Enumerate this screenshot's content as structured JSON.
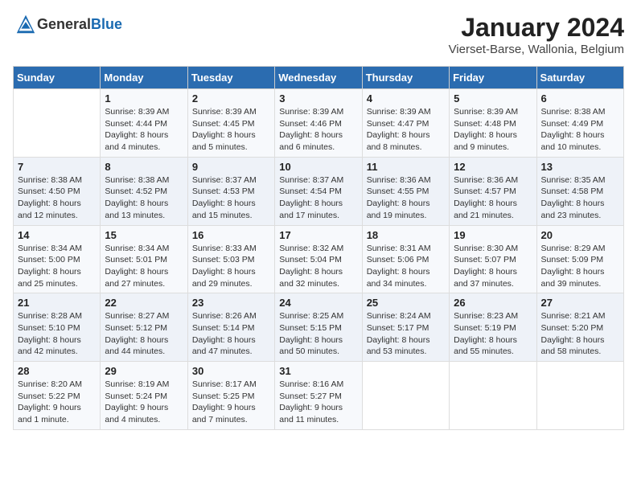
{
  "header": {
    "logo_general": "General",
    "logo_blue": "Blue",
    "month_title": "January 2024",
    "location": "Vierset-Barse, Wallonia, Belgium"
  },
  "weekdays": [
    "Sunday",
    "Monday",
    "Tuesday",
    "Wednesday",
    "Thursday",
    "Friday",
    "Saturday"
  ],
  "weeks": [
    [
      {
        "day": "",
        "sunrise": "",
        "sunset": "",
        "daylight": ""
      },
      {
        "day": "1",
        "sunrise": "Sunrise: 8:39 AM",
        "sunset": "Sunset: 4:44 PM",
        "daylight": "Daylight: 8 hours and 4 minutes."
      },
      {
        "day": "2",
        "sunrise": "Sunrise: 8:39 AM",
        "sunset": "Sunset: 4:45 PM",
        "daylight": "Daylight: 8 hours and 5 minutes."
      },
      {
        "day": "3",
        "sunrise": "Sunrise: 8:39 AM",
        "sunset": "Sunset: 4:46 PM",
        "daylight": "Daylight: 8 hours and 6 minutes."
      },
      {
        "day": "4",
        "sunrise": "Sunrise: 8:39 AM",
        "sunset": "Sunset: 4:47 PM",
        "daylight": "Daylight: 8 hours and 8 minutes."
      },
      {
        "day": "5",
        "sunrise": "Sunrise: 8:39 AM",
        "sunset": "Sunset: 4:48 PM",
        "daylight": "Daylight: 8 hours and 9 minutes."
      },
      {
        "day": "6",
        "sunrise": "Sunrise: 8:38 AM",
        "sunset": "Sunset: 4:49 PM",
        "daylight": "Daylight: 8 hours and 10 minutes."
      }
    ],
    [
      {
        "day": "7",
        "sunrise": "Sunrise: 8:38 AM",
        "sunset": "Sunset: 4:50 PM",
        "daylight": "Daylight: 8 hours and 12 minutes."
      },
      {
        "day": "8",
        "sunrise": "Sunrise: 8:38 AM",
        "sunset": "Sunset: 4:52 PM",
        "daylight": "Daylight: 8 hours and 13 minutes."
      },
      {
        "day": "9",
        "sunrise": "Sunrise: 8:37 AM",
        "sunset": "Sunset: 4:53 PM",
        "daylight": "Daylight: 8 hours and 15 minutes."
      },
      {
        "day": "10",
        "sunrise": "Sunrise: 8:37 AM",
        "sunset": "Sunset: 4:54 PM",
        "daylight": "Daylight: 8 hours and 17 minutes."
      },
      {
        "day": "11",
        "sunrise": "Sunrise: 8:36 AM",
        "sunset": "Sunset: 4:55 PM",
        "daylight": "Daylight: 8 hours and 19 minutes."
      },
      {
        "day": "12",
        "sunrise": "Sunrise: 8:36 AM",
        "sunset": "Sunset: 4:57 PM",
        "daylight": "Daylight: 8 hours and 21 minutes."
      },
      {
        "day": "13",
        "sunrise": "Sunrise: 8:35 AM",
        "sunset": "Sunset: 4:58 PM",
        "daylight": "Daylight: 8 hours and 23 minutes."
      }
    ],
    [
      {
        "day": "14",
        "sunrise": "Sunrise: 8:34 AM",
        "sunset": "Sunset: 5:00 PM",
        "daylight": "Daylight: 8 hours and 25 minutes."
      },
      {
        "day": "15",
        "sunrise": "Sunrise: 8:34 AM",
        "sunset": "Sunset: 5:01 PM",
        "daylight": "Daylight: 8 hours and 27 minutes."
      },
      {
        "day": "16",
        "sunrise": "Sunrise: 8:33 AM",
        "sunset": "Sunset: 5:03 PM",
        "daylight": "Daylight: 8 hours and 29 minutes."
      },
      {
        "day": "17",
        "sunrise": "Sunrise: 8:32 AM",
        "sunset": "Sunset: 5:04 PM",
        "daylight": "Daylight: 8 hours and 32 minutes."
      },
      {
        "day": "18",
        "sunrise": "Sunrise: 8:31 AM",
        "sunset": "Sunset: 5:06 PM",
        "daylight": "Daylight: 8 hours and 34 minutes."
      },
      {
        "day": "19",
        "sunrise": "Sunrise: 8:30 AM",
        "sunset": "Sunset: 5:07 PM",
        "daylight": "Daylight: 8 hours and 37 minutes."
      },
      {
        "day": "20",
        "sunrise": "Sunrise: 8:29 AM",
        "sunset": "Sunset: 5:09 PM",
        "daylight": "Daylight: 8 hours and 39 minutes."
      }
    ],
    [
      {
        "day": "21",
        "sunrise": "Sunrise: 8:28 AM",
        "sunset": "Sunset: 5:10 PM",
        "daylight": "Daylight: 8 hours and 42 minutes."
      },
      {
        "day": "22",
        "sunrise": "Sunrise: 8:27 AM",
        "sunset": "Sunset: 5:12 PM",
        "daylight": "Daylight: 8 hours and 44 minutes."
      },
      {
        "day": "23",
        "sunrise": "Sunrise: 8:26 AM",
        "sunset": "Sunset: 5:14 PM",
        "daylight": "Daylight: 8 hours and 47 minutes."
      },
      {
        "day": "24",
        "sunrise": "Sunrise: 8:25 AM",
        "sunset": "Sunset: 5:15 PM",
        "daylight": "Daylight: 8 hours and 50 minutes."
      },
      {
        "day": "25",
        "sunrise": "Sunrise: 8:24 AM",
        "sunset": "Sunset: 5:17 PM",
        "daylight": "Daylight: 8 hours and 53 minutes."
      },
      {
        "day": "26",
        "sunrise": "Sunrise: 8:23 AM",
        "sunset": "Sunset: 5:19 PM",
        "daylight": "Daylight: 8 hours and 55 minutes."
      },
      {
        "day": "27",
        "sunrise": "Sunrise: 8:21 AM",
        "sunset": "Sunset: 5:20 PM",
        "daylight": "Daylight: 8 hours and 58 minutes."
      }
    ],
    [
      {
        "day": "28",
        "sunrise": "Sunrise: 8:20 AM",
        "sunset": "Sunset: 5:22 PM",
        "daylight": "Daylight: 9 hours and 1 minute."
      },
      {
        "day": "29",
        "sunrise": "Sunrise: 8:19 AM",
        "sunset": "Sunset: 5:24 PM",
        "daylight": "Daylight: 9 hours and 4 minutes."
      },
      {
        "day": "30",
        "sunrise": "Sunrise: 8:17 AM",
        "sunset": "Sunset: 5:25 PM",
        "daylight": "Daylight: 9 hours and 7 minutes."
      },
      {
        "day": "31",
        "sunrise": "Sunrise: 8:16 AM",
        "sunset": "Sunset: 5:27 PM",
        "daylight": "Daylight: 9 hours and 11 minutes."
      },
      {
        "day": "",
        "sunrise": "",
        "sunset": "",
        "daylight": ""
      },
      {
        "day": "",
        "sunrise": "",
        "sunset": "",
        "daylight": ""
      },
      {
        "day": "",
        "sunrise": "",
        "sunset": "",
        "daylight": ""
      }
    ]
  ]
}
